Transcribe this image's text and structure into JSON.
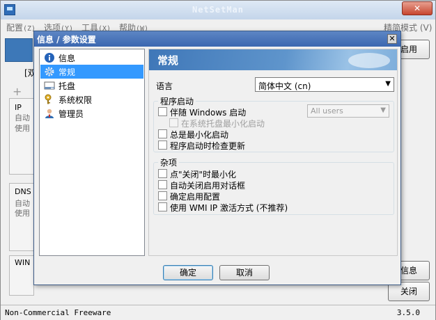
{
  "main_window": {
    "title": "NetSetMan",
    "close_label": "✕",
    "menu": [
      {
        "label": "配置",
        "hotkey": "(Z)"
      },
      {
        "label": "选项",
        "hotkey": "(Y)"
      },
      {
        "label": "工具",
        "hotkey": "(X)"
      },
      {
        "label": "帮助",
        "hotkey": "(W)"
      }
    ],
    "mode_toggle": "精简模式 (V)",
    "side_button_apply": "启用",
    "side_button_info": "信息",
    "side_button_close": "关闭",
    "partial_text_dual": "[双",
    "partial_ip": "IP",
    "partial_auto1": "自动",
    "partial_use1": "使用",
    "partial_dns": "DNS",
    "partial_auto2": "自动",
    "partial_use2": "使用",
    "partial_win": "WIN"
  },
  "status_bar": {
    "left": "Non-Commercial Freeware",
    "right": "3.5.0"
  },
  "dialog": {
    "title": "信息 / 参数设置",
    "close_label": "✕",
    "nav_items": [
      {
        "label": "信息",
        "icon": "info-icon"
      },
      {
        "label": "常规",
        "icon": "gear-icon",
        "selected": true
      },
      {
        "label": "托盘",
        "icon": "tray-icon"
      },
      {
        "label": "系统权限",
        "icon": "key-icon"
      },
      {
        "label": "管理员",
        "icon": "admin-user-icon"
      }
    ],
    "section_title": "常规",
    "language_label": "语言",
    "language_value": "简体中文 (cn)",
    "startup_group": {
      "title": "程序启动",
      "start_with_windows": "伴随 Windows 启动",
      "users_value": "All users",
      "minimized_tray": "在系统托盘最小化启动",
      "always_minimize": "总是最小化启动",
      "check_updates": "程序启动时检查更新"
    },
    "misc_group": {
      "title": "杂项",
      "minimize_on_close": "点\"关闭\"时最小化",
      "auto_close_activation": "自动关闭启用对话框",
      "confirm_activation": "确定启用配置",
      "wmi_activation": "使用 WMI IP 激活方式 (不推荐)"
    },
    "ok_label": "确定",
    "cancel_label": "取消"
  }
}
